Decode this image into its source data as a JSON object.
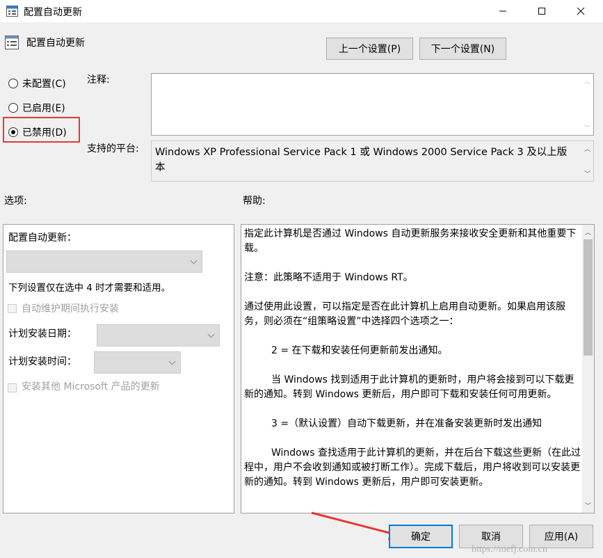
{
  "window": {
    "title": "配置自动更新",
    "controls": {
      "minimize": "—",
      "maximize": "☐",
      "close": "✕"
    }
  },
  "header": {
    "policy_title": "配置自动更新",
    "prev_button": "上一个设置(P)",
    "next_button": "下一个设置(N)"
  },
  "state": {
    "options": [
      {
        "label": "未配置(C)",
        "checked": false
      },
      {
        "label": "已启用(E)",
        "checked": false
      },
      {
        "label": "已禁用(D)",
        "checked": true
      }
    ]
  },
  "comment": {
    "label": "注释:",
    "value": ""
  },
  "platform": {
    "label": "支持的平台:",
    "value": "Windows XP Professional Service Pack 1 或 Windows 2000 Service Pack 3 及以上版本"
  },
  "options_section": {
    "label": "选项:",
    "configure_label": "配置自动更新：",
    "note": "下列设置仅在选中 4 时才需要和适用。",
    "auto_maint": "自动维护期间执行安装",
    "schedule_day_label": "计划安装日期：",
    "schedule_time_label": "计划安装时间：",
    "other_products": "安装其他 Microsoft 产品的更新"
  },
  "help_section": {
    "label": "帮助:",
    "paragraphs": [
      "指定此计算机是否通过 Windows 自动更新服务来接收安全更新和其他重要下载。",
      "注意：此策略不适用于 Windows RT。",
      "通过使用此设置，可以指定是否在此计算机上启用自动更新。如果启用该服务，则必须在“组策略设置”中选择四个选项之一：",
      "2 = 在下载和安装任何更新前发出通知。",
      "当 Windows 找到适用于此计算机的更新时，用户将会接到可以下载更新的通知。转到 Windows 更新后，用户即可下载和安装任何可用更新。",
      "3 =（默认设置）自动下载更新，并在准备安装更新时发出通知",
      "Windows 查找适用于此计算机的更新，并在后台下载这些更新（在此过程中，用户不会收到通知或被打断工作）。完成下载后，用户将收到可以安装更新的通知。转到 Windows 更新后，用户即可安装更新。"
    ]
  },
  "footer": {
    "ok": "确定",
    "cancel": "取消",
    "apply": "应用(A)"
  },
  "watermark": "https://mefj.com.cn",
  "colors": {
    "highlight": "#e53935",
    "accent": "#0078d7"
  }
}
